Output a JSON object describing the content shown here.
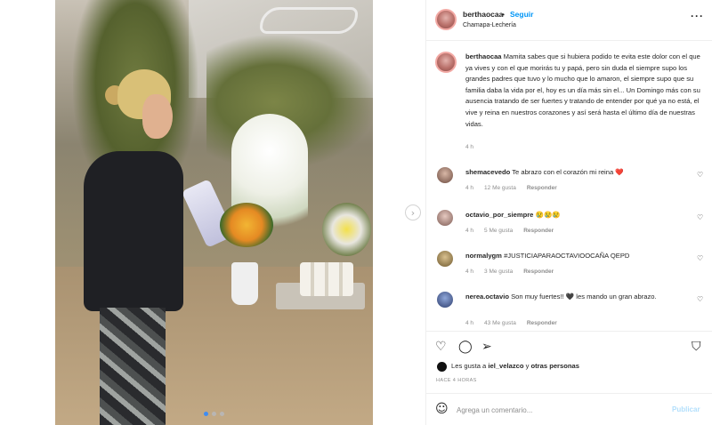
{
  "post": {
    "username": "berthaocaa",
    "separator": "•",
    "follow_label": "Seguir",
    "location": "Chamapa-Lechería",
    "more_icon": "more-horizontal-icon",
    "photo_dots": 3,
    "active_dot": 1
  },
  "caption": {
    "username": "berthaocaa",
    "text": "Mamita sabes que si hubiera podido te evita este dolor con el que ya vives y con el que morirás tu y papá, pero sin duda el siempre supo los grandes padres que tuvo y lo mucho que lo amaron, el siempre supo que su familia daba la vida por el, hoy es un día más sin el... Un Domingo más con su ausencia tratando de ser fuertes y tratando de entender por qué ya no está, el vive y reina en nuestros corazones y así será hasta el último día de nuestras vidas.",
    "time": "4 h"
  },
  "comments": [
    {
      "username": "shemacevedo",
      "text": "Te abrazo con el corazón mi reina ❤️",
      "time": "4 h",
      "likes": "12 Me gusta",
      "reply": "Responder"
    },
    {
      "username": "octavio_por_siempre",
      "text": "😢😢😢",
      "time": "4 h",
      "likes": "5 Me gusta",
      "reply": "Responder"
    },
    {
      "username": "normalygm",
      "text": "#JUSTICIAPARAOCTAVIOOCAÑA QEPD",
      "time": "4 h",
      "likes": "3 Me gusta",
      "reply": "Responder"
    },
    {
      "username": "nerea.octavio",
      "text": "Son muy fuertes!! 🖤 les mando un gran abrazo.",
      "time": "4 h",
      "likes": "43 Me gusta",
      "reply": "Responder"
    }
  ],
  "actions": {
    "like_icon": "heart-icon",
    "comment_icon": "comment-icon",
    "share_icon": "share-icon",
    "save_icon": "bookmark-icon"
  },
  "likes": {
    "prefix": "Les gusta a ",
    "user": "iel_velazco",
    "suffix": " y ",
    "others": "otras personas"
  },
  "time_ago": "HACE 4 HORAS",
  "add_comment": {
    "placeholder": "Agrega un comentario...",
    "publish_label": "Publicar",
    "emoji_icon": "smiley-icon"
  }
}
